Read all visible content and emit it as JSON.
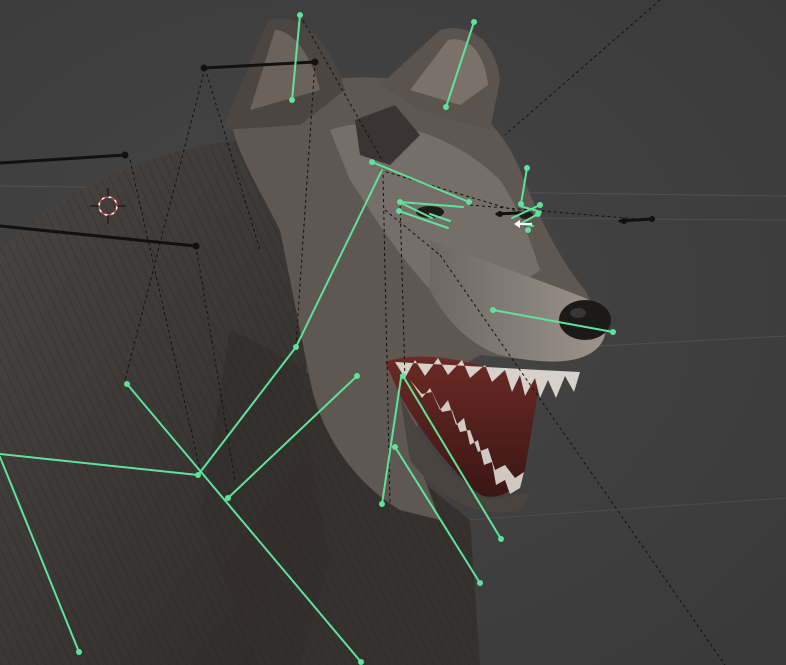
{
  "viewport": {
    "label": "",
    "background": "#3d3d3d"
  },
  "colors": {
    "bone_selected": "#5fe39a",
    "bone_unselected": "#111111",
    "relationship_line": "#111111",
    "grid_line": "#5a5a5a",
    "cursor_ring_red": "#d9433f",
    "cursor_ring_white": "#ffffff"
  },
  "icons": {
    "cursor": "3d-cursor-icon",
    "model": "wolf-head-mesh"
  },
  "armature": {
    "selected_bone_count": 22,
    "unselected_bone_count": 5,
    "relationship_line_count": 13
  }
}
